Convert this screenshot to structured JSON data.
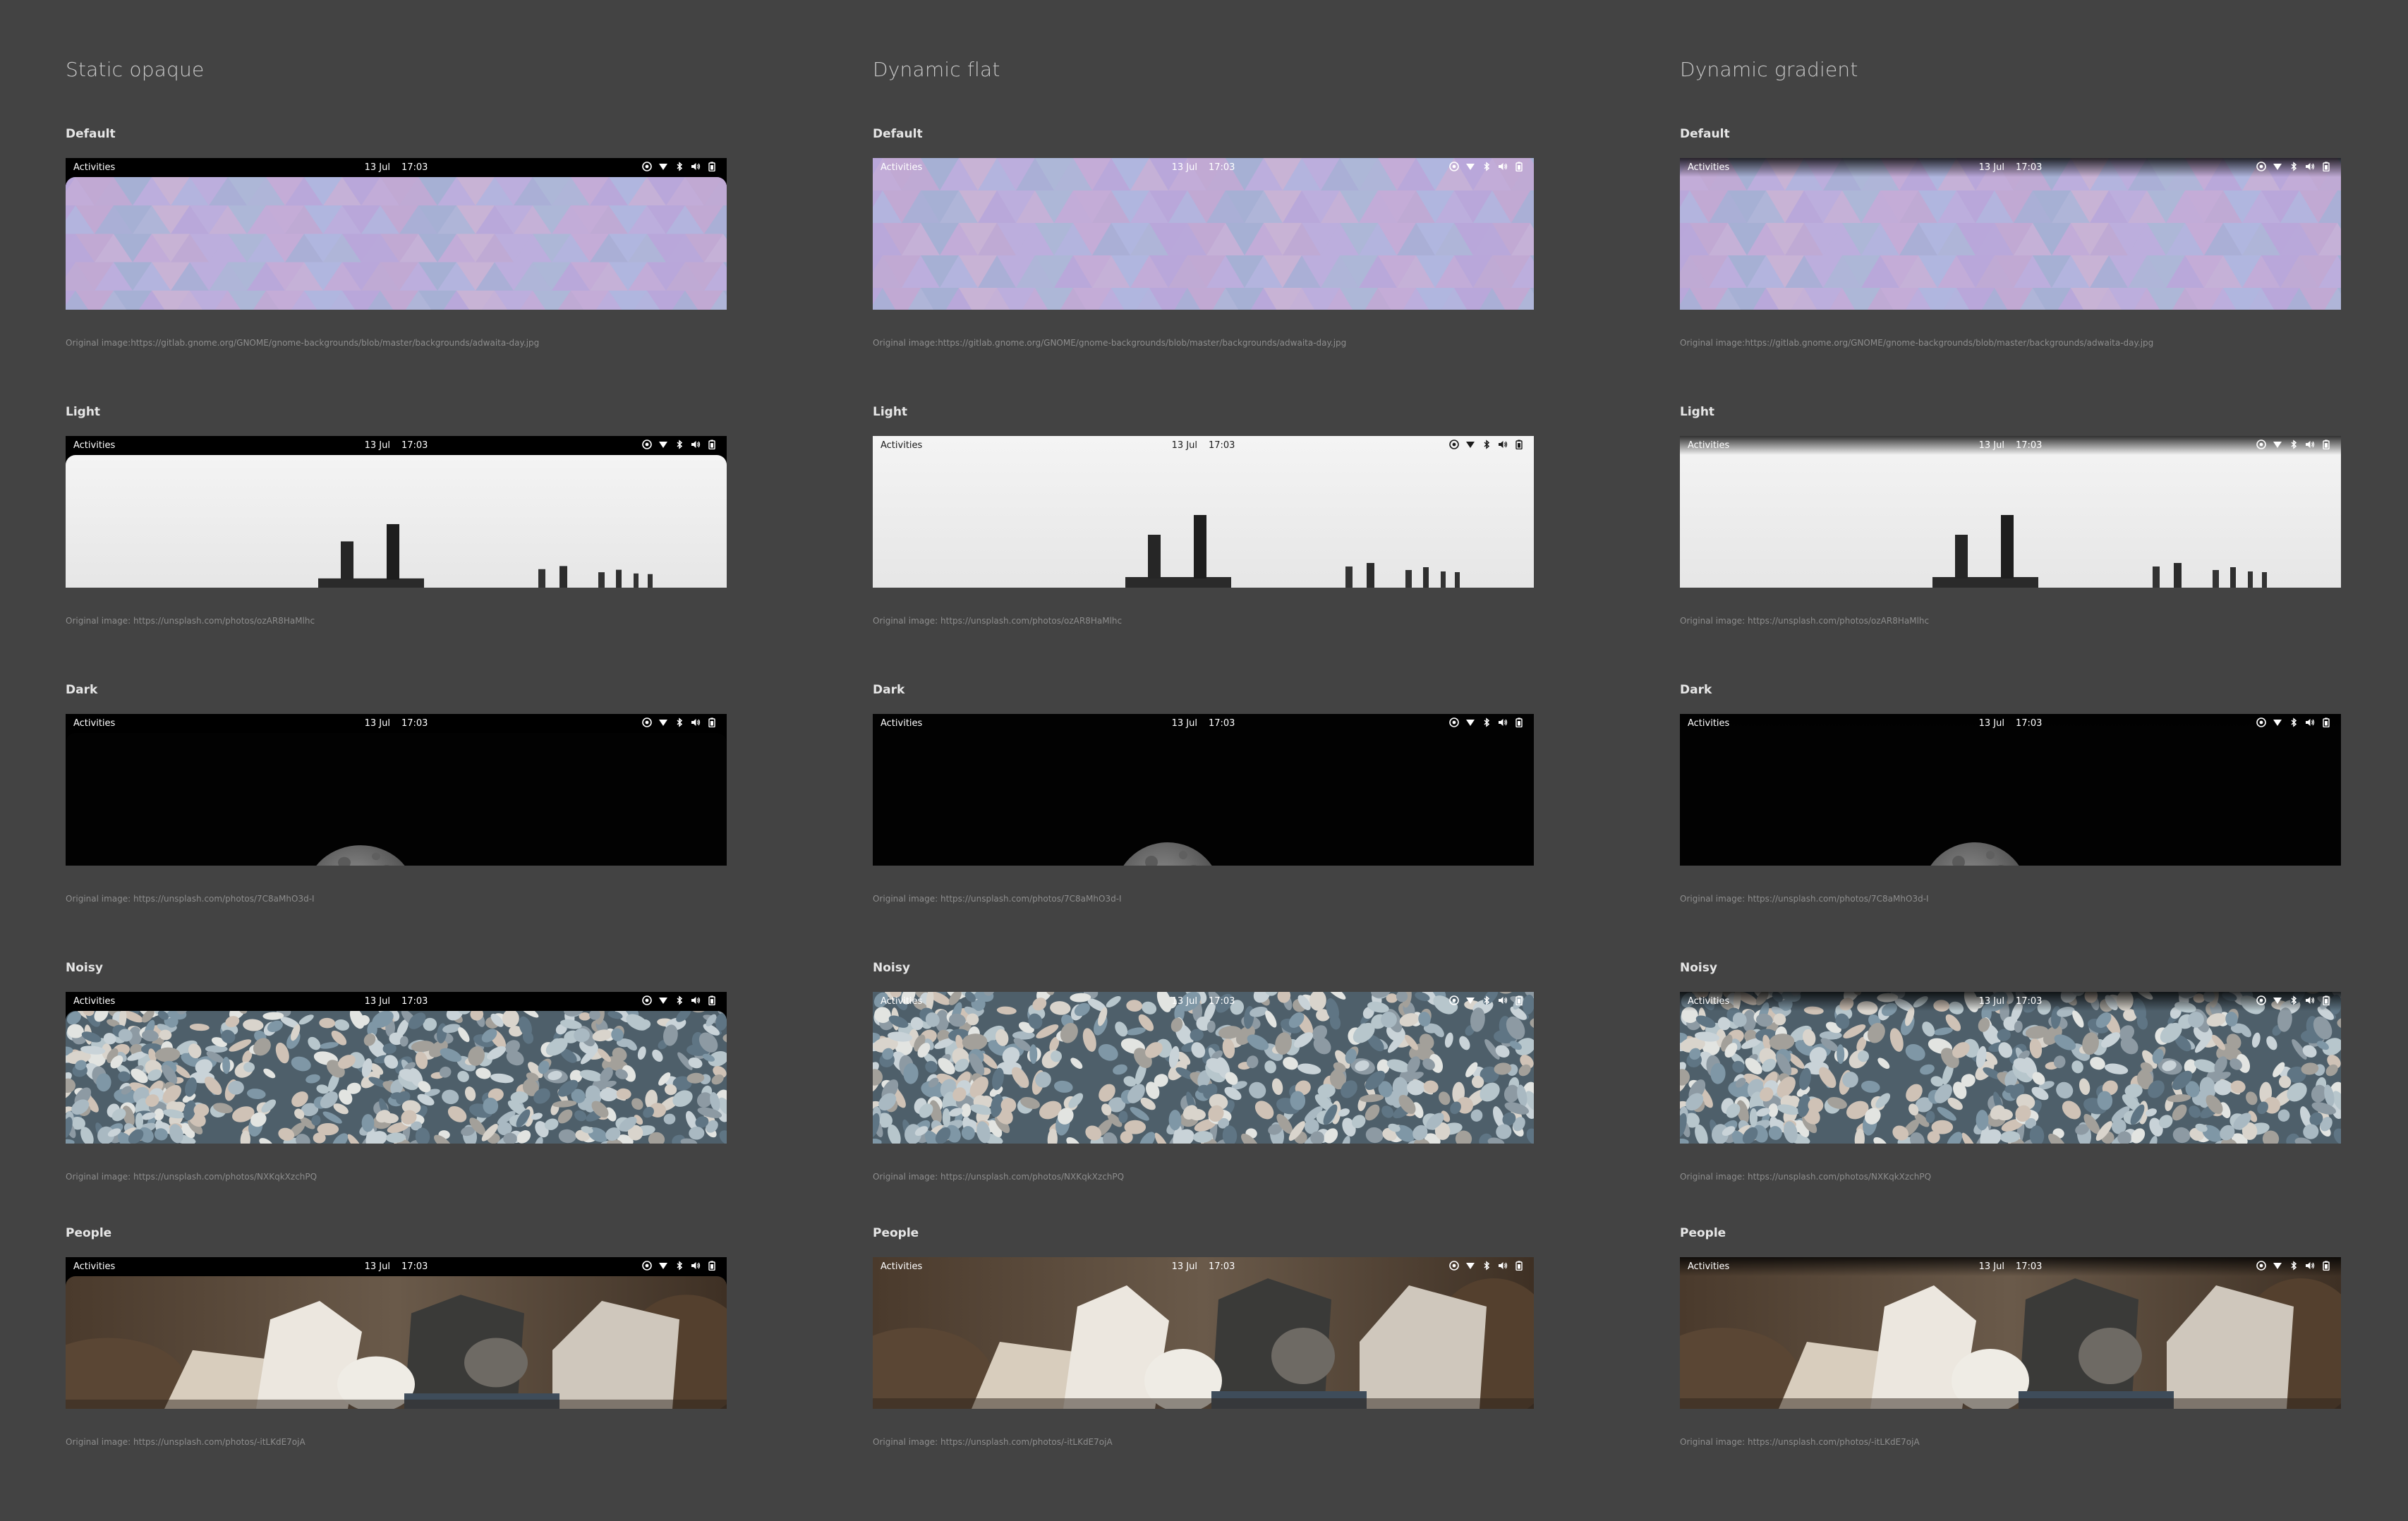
{
  "columns": [
    {
      "title": "Static opaque"
    },
    {
      "title": "Dynamic flat"
    },
    {
      "title": "Dynamic gradient"
    }
  ],
  "topbar": {
    "activities": "Activities",
    "date": "13 Jul",
    "time": "17:03",
    "tray_icons": [
      "accessibility-icon",
      "wifi-icon",
      "bluetooth-icon",
      "volume-icon",
      "battery-icon"
    ]
  },
  "rows": [
    {
      "label": "Default",
      "captions": [
        "Original image:https://gitlab.gnome.org/GNOME/gnome-backgrounds/blob/master/backgrounds/adwaita-day.jpg",
        "Original image:https://gitlab.gnome.org/GNOME/gnome-backgrounds/blob/master/backgrounds/adwaita-day.jpg",
        "Original image:https://gitlab.gnome.org/GNOME/gnome-backgrounds/blob/master/backgrounds/adwaita-day.jpg"
      ]
    },
    {
      "label": "Light",
      "captions": [
        "Original image: https://unsplash.com/photos/ozAR8HaMlhc",
        "Original image: https://unsplash.com/photos/ozAR8HaMlhc",
        "Original image: https://unsplash.com/photos/ozAR8HaMlhc"
      ]
    },
    {
      "label": "Dark",
      "captions": [
        "Original image: https://unsplash.com/photos/7C8aMhO3d-I",
        "Original image: https://unsplash.com/photos/7C8aMhO3d-I",
        "Original image: https://unsplash.com/photos/7C8aMhO3d-I"
      ]
    },
    {
      "label": "Noisy",
      "captions": [
        "Original image: https://unsplash.com/photos/NXKqkXzchPQ",
        "Original image: https://unsplash.com/photos/NXKqkXzchPQ",
        "Original image: https://unsplash.com/photos/NXKqkXzchPQ"
      ]
    },
    {
      "label": "People",
      "captions": [
        "Original image: https://unsplash.com/photos/-itLKdE7ojA",
        "Original image: https://unsplash.com/photos/-itLKdE7ojA",
        "Original image: https://unsplash.com/photos/-itLKdE7ojA"
      ]
    }
  ],
  "colors": {
    "page_background": "#434343",
    "opaque_bar": "#000000"
  }
}
